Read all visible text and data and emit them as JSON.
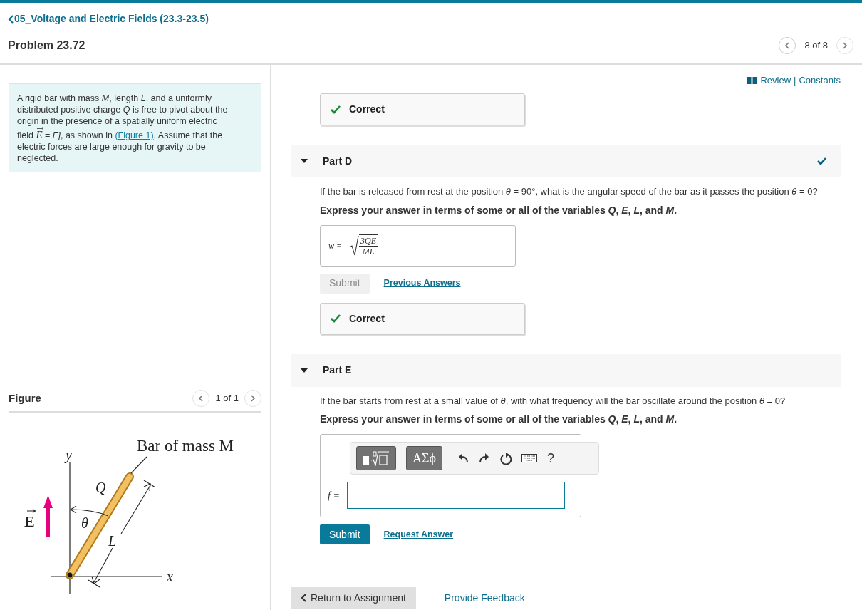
{
  "header": {
    "back_link": "05_Voltage and Electric Fields (23.3-23.5)",
    "title": "Problem 23.72",
    "pager": "8 of 8"
  },
  "problem": {
    "segments": [
      {
        "kind": "text",
        "text": "A rigid bar with mass *M*, length *L*, and a uniformly distributed positive charge *Q* is free to pivot about the origin in the presence of a spatially uniform electric field "
      },
      {
        "kind": "vector",
        "text": "E"
      },
      {
        "kind": "text",
        "text": " = *Eĵ*, as shown in "
      },
      {
        "kind": "link",
        "text": "(Figure 1)"
      },
      {
        "kind": "text",
        "text": ". Assume that the electric forces are large enough for gravity to be neglected."
      }
    ]
  },
  "figure": {
    "title": "Figure",
    "pager": "1 of 1",
    "labels": {
      "bar": "Bar of mass M",
      "y": "y",
      "x": "x",
      "charge": "Q",
      "angle": "θ",
      "length": "L",
      "field": {
        "text": "E",
        "vector": true
      }
    }
  },
  "resources": {
    "review": "Review",
    "separator": "|",
    "constants": "Constants"
  },
  "top_feedback": {
    "kind": "correct",
    "text": "Correct"
  },
  "parts": [
    {
      "title": "Part D",
      "expanded": true,
      "completed": true,
      "question": "If the bar is released from rest at the position *θ* = 90°, what is the angular speed of the bar as it passes the position *θ* = 0?",
      "instruction": "Express your answer in terms of some or all of the variables *Q*, *E*, *L*, and *M*.",
      "answer": {
        "kind": "sqrt_fraction",
        "label": "w =",
        "numerator": "3QE",
        "denominator": "ML"
      },
      "submit": {
        "label": "Submit",
        "disabled": true
      },
      "link": "Previous Answers",
      "feedback": {
        "kind": "correct",
        "text": "Correct"
      }
    },
    {
      "title": "Part E",
      "expanded": true,
      "completed": false,
      "question": "If the bar starts from rest at a small value of *θ*, with what frequency will the bar oscillate around the position *θ* = 0?",
      "instruction": "Express your answer in terms of some or all of the variables *Q*, *E*, *L*, and *M*.",
      "answer": {
        "kind": "input",
        "label": "f =",
        "greek": "ΑΣϕ",
        "help": "?"
      },
      "submit": {
        "label": "Submit",
        "disabled": false
      },
      "link": "Request Answer"
    }
  ],
  "footer": {
    "return": "Return to Assignment",
    "feedback": "Provide Feedback"
  }
}
